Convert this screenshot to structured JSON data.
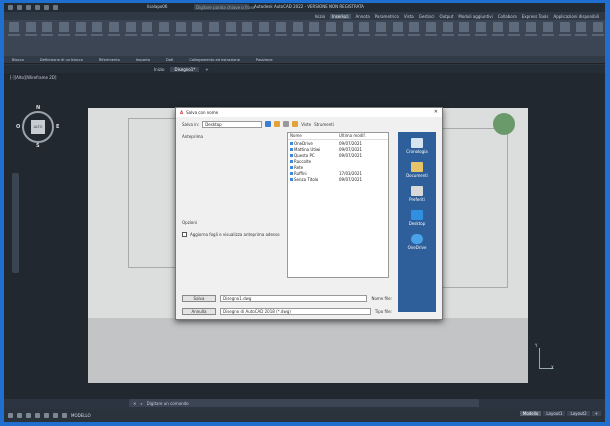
{
  "app": {
    "title": "Autodesk AutoCAD 2022 - VERSIONE NON REGISTRATA",
    "search_placeholder": "Digitare parola chiave o frase",
    "user": "lisalapo06"
  },
  "ribbon": {
    "tabs": [
      "Inizio",
      "Inserisci",
      "Annota",
      "Parametrico",
      "Vista",
      "Gestisci",
      "Output",
      "Moduli aggiuntivi",
      "Collabora",
      "Express Tools",
      "Applicazioni disponibili"
    ],
    "active_tab": "Inserisci",
    "groups": [
      "Blocco",
      "Definizione di un blocco",
      "Riferimento",
      "Importa",
      "Dati",
      "Collegamento ed estrazione",
      "Posizione"
    ]
  },
  "doc": {
    "tabs": [
      "Inizio",
      "Disegno1*"
    ],
    "active": "Disegno1*",
    "view_label": "[-][Alto][Wireframe 2D]"
  },
  "viewcube": {
    "north": "N",
    "south": "S",
    "east": "E",
    "west": "O",
    "face": "ALTO"
  },
  "axes": {
    "y": "Y",
    "x": "X"
  },
  "cmd": {
    "placeholder": "Digitare un comando"
  },
  "status": {
    "model": "MODELLO"
  },
  "layout_tabs": [
    "Modello",
    "Layout1",
    "Layout2"
  ],
  "dialog": {
    "title": "Salva con nome",
    "save_in_label": "Salva in:",
    "folder": "Desktop",
    "views_label": "Viste",
    "tools_label": "Strumenti",
    "places": [
      "Cronologia",
      "Documenti",
      "Preferiti",
      "Desktop",
      "OneDrive"
    ],
    "columns": [
      "Nome",
      "Ultima modif."
    ],
    "files": [
      {
        "name": "OneDrive",
        "date": "09/07/2021"
      },
      {
        "name": "Mattina Utiwi",
        "date": "09/07/2021"
      },
      {
        "name": "Questo PC",
        "date": "09/07/2021"
      },
      {
        "name": "Raccolte",
        "date": ""
      },
      {
        "name": "Rete",
        "date": ""
      },
      {
        "name": "Ruffini",
        "date": "17/03/2021"
      },
      {
        "name": "Senza Titolo",
        "date": "09/07/2021"
      }
    ],
    "preview_label": "Anteprima",
    "options_label": "Opzioni",
    "checkbox_label": "Aggiorna fogli e visualizza anteprima adesso",
    "filename_label": "Nome file:",
    "filename": "Disegno1.dwg",
    "filetype_label": "Tipo file:",
    "filetype": "Disegno di AutoCAD 2018 (*.dwg)",
    "save_button": "Salva",
    "cancel_button": "Annulla"
  },
  "colors": {
    "accent": "#1f6fd1",
    "canvas": "#212830",
    "ribbon": "#3b4553"
  }
}
